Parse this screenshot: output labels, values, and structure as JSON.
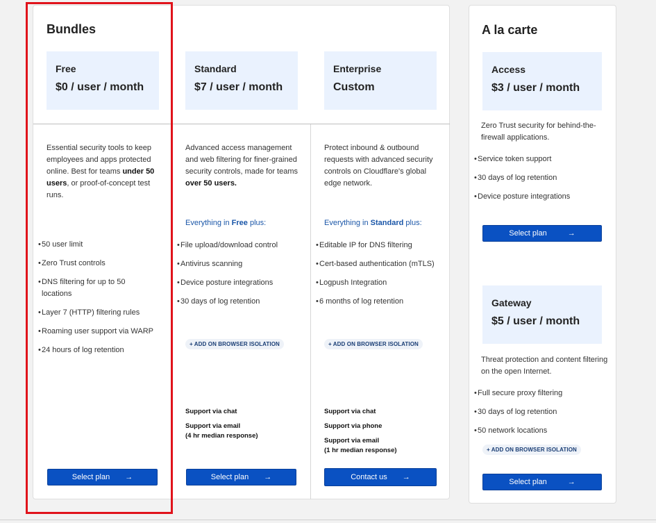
{
  "bundles": {
    "title": "Bundles",
    "plans": [
      {
        "name": "Free",
        "price": "$0 / user / month",
        "desc_parts": [
          "Essential security tools to keep employees and apps protected online. Best for teams ",
          "under 50 users",
          ", or proof-of-concept test runs."
        ],
        "everything": null,
        "features": [
          "50 user limit",
          "Zero Trust controls",
          "DNS filtering for up to 50 locations",
          "Layer 7 (HTTP) filtering rules",
          "Roaming user support via WARP",
          "24 hours of log retention"
        ],
        "addon": null,
        "support": [],
        "button": "Select plan"
      },
      {
        "name": "Standard",
        "price": "$7 / user / month",
        "desc_parts": [
          "Advanced access management and web filtering for finer-grained security controls, made for teams ",
          "over 50 users.",
          ""
        ],
        "everything": {
          "prefix": "Everything in ",
          "plan": "Free",
          "suffix": " plus:"
        },
        "features": [
          "File upload/download control",
          "Antivirus scanning",
          "Device posture integrations",
          "30 days of log retention"
        ],
        "addon": "+ ADD ON BROWSER ISOLATION",
        "support": [
          "Support via chat",
          "Support via email",
          "(4 hr median response)"
        ],
        "button": "Select plan"
      },
      {
        "name": "Enterprise",
        "price": "Custom",
        "desc_parts": [
          "Protect inbound & outbound requests with advanced security controls on Cloudflare's global edge network.",
          "",
          ""
        ],
        "everything": {
          "prefix": "Everything in ",
          "plan": "Standard",
          "suffix": " plus:"
        },
        "features": [
          "Editable IP for DNS filtering",
          "Cert-based authentication (mTLS)",
          "Logpush Integration",
          "6 months of log retention"
        ],
        "addon": "+ ADD ON BROWSER ISOLATION",
        "support": [
          "Support via chat",
          "Support via phone",
          "Support via email",
          "(1 hr median response)"
        ],
        "button": "Contact us"
      }
    ]
  },
  "alacarte": {
    "title": "A la carte",
    "access": {
      "name": "Access",
      "price": "$3 / user / month",
      "desc": "Zero Trust security for behind-the-firewall applications.",
      "features": [
        "Service token support",
        "30 days of log retention",
        "Device posture integrations"
      ],
      "button": "Select plan"
    },
    "gateway": {
      "name": "Gateway",
      "price": "$5 / user / month",
      "desc": "Threat protection and content filtering on the open Internet.",
      "features": [
        "Full secure proxy filtering",
        "30 days of log retention",
        "50 network locations"
      ],
      "addon": "+ ADD ON BROWSER ISOLATION",
      "button": "Select plan"
    }
  },
  "arrow_glyph": "→",
  "bullet_glyph": "•",
  "colors": {
    "button": "#0a51c2",
    "plan_box": "#eaf2fe",
    "highlight": "#e0131b",
    "link": "#1a56a8"
  }
}
